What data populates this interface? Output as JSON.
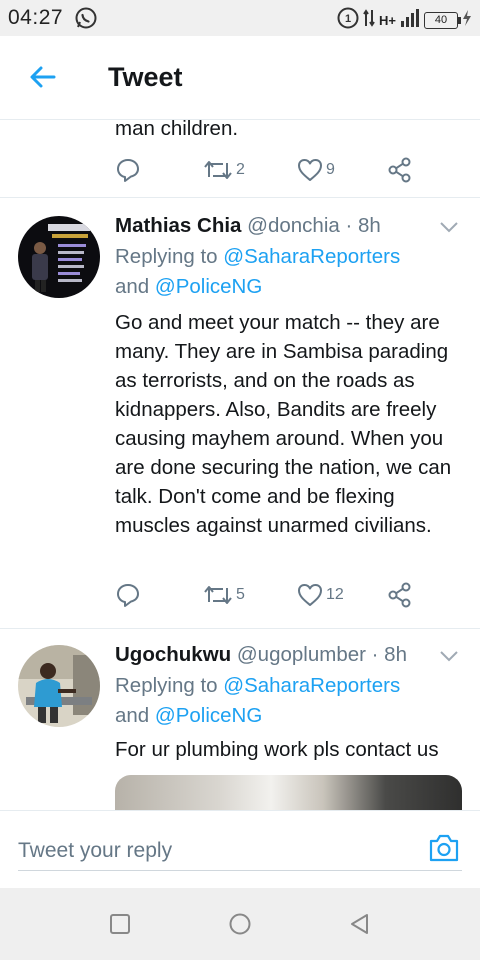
{
  "status_bar": {
    "time": "04:27",
    "network": "H+",
    "battery": "40",
    "icons": [
      "whatsapp-icon",
      "sim-icon",
      "signal-icon",
      "battery-icon",
      "charging-icon"
    ]
  },
  "header": {
    "back_icon": "arrow-left-icon",
    "title": "Tweet"
  },
  "previous_tweet": {
    "tail_text": "man children.",
    "retweets": "2",
    "likes": "9"
  },
  "tweets": [
    {
      "name": "Mathias Chia",
      "handle": "@donchia",
      "time": "· 8h",
      "replying_prefix": "Replying to ",
      "mention_1": "@SaharaReporters",
      "and": "and ",
      "mention_2": "@PoliceNG",
      "body": "Go and meet your match -- they are many.  They are in Sambisa parading as terrorists, and on the roads as kidnappers. Also, Bandits are freely causing mayhem around. When you are done securing the nation, we can talk. Don't come and be flexing muscles against unarmed civilians.",
      "retweets": "5",
      "likes": "12"
    },
    {
      "name": "Ugochukwu",
      "handle": "@ugoplumber",
      "time": "· 8h",
      "replying_prefix": "Replying to ",
      "mention_1": "@SaharaReporters",
      "and": "and ",
      "mention_2": "@PoliceNG",
      "body": "For ur plumbing work pls contact us"
    }
  ],
  "reply_box": {
    "placeholder": "Tweet your reply",
    "camera_icon": "camera-icon"
  },
  "colors": {
    "accent": "#1da1f2",
    "text": "#14171a",
    "secondary": "#657786",
    "divider": "#e6ecf0"
  }
}
